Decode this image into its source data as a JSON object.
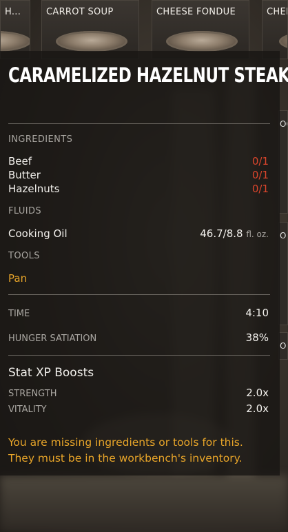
{
  "recipe_tiles": [
    {
      "label": "H..."
    },
    {
      "label": "CARROT SOUP"
    },
    {
      "label": "CHEESE FONDUE"
    },
    {
      "label": "CHEE"
    }
  ],
  "side_tiles": [
    "OC",
    "O",
    "O"
  ],
  "tooltip": {
    "title": "CARAMELIZED HAZELNUT STEAK",
    "ingredients_label": "INGREDIENTS",
    "ingredients": [
      {
        "name": "Beef",
        "amount": "0/1"
      },
      {
        "name": "Butter",
        "amount": "0/1"
      },
      {
        "name": "Hazelnuts",
        "amount": "0/1"
      }
    ],
    "fluids_label": "FLUIDS",
    "fluids": [
      {
        "name": "Cooking Oil",
        "amount": "46.7/8.8",
        "unit": "fl. oz."
      }
    ],
    "tools_label": "TOOLS",
    "tools": [
      {
        "name": "Pan"
      }
    ],
    "time_label": "TIME",
    "time_value": "4:10",
    "hunger_label": "HUNGER SATIATION",
    "hunger_value": "38%",
    "stat_header": "Stat XP Boosts",
    "stats": [
      {
        "name": "STRENGTH",
        "value": "2.0x"
      },
      {
        "name": "VITALITY",
        "value": "2.0x"
      }
    ],
    "warning_line1": "You are missing ingredients or tools for this.",
    "warning_line2": "They must be in the workbench's inventory."
  },
  "colors": {
    "missing": "#d9452c",
    "warning": "#e8a529",
    "panel_bg": "#181614"
  }
}
